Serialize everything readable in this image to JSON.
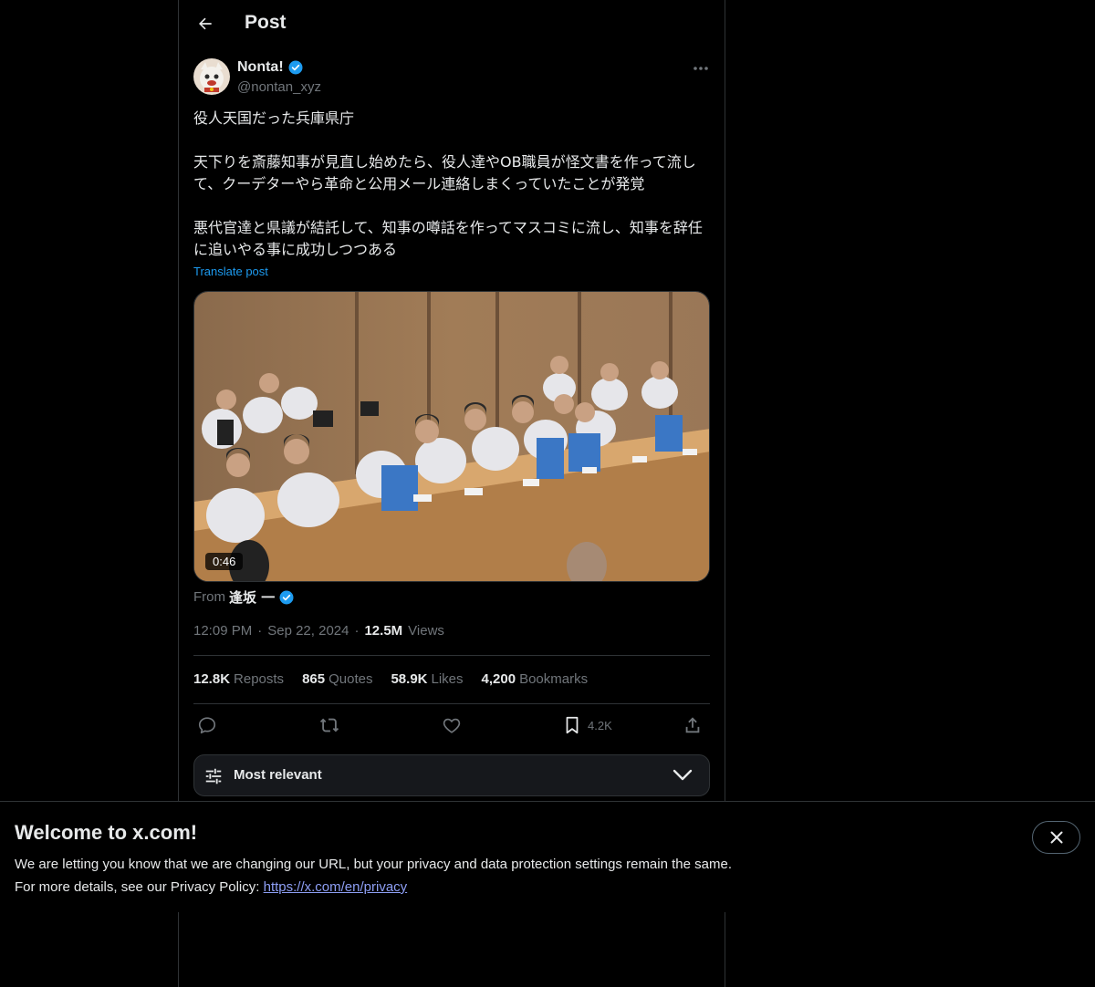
{
  "header": {
    "title": "Post"
  },
  "post": {
    "author_name": "Nonta!",
    "author_handle": "@nontan_xyz",
    "text": "役人天国だった兵庫県庁\n\n天下りを斎藤知事が見直し始めたら、役人達やOB職員が怪文書を作って流して、クーデターやら革命と公用メール連絡しまくっていたことが発覚\n\n悪代官達と県議が結託して、知事の噂話を作ってマスコミに流し、知事を辞任に追いやる事に成功しつつある",
    "translate_label": "Translate post",
    "video_duration": "0:46",
    "from_prefix": "From",
    "from_name": "逢坂 一",
    "time": "12:09 PM",
    "date": "Sep 22, 2024",
    "separator": "·",
    "views_count": "12.5M",
    "views_label": "Views"
  },
  "stats": [
    {
      "num": "12.8K",
      "label": "Reposts"
    },
    {
      "num": "865",
      "label": "Quotes"
    },
    {
      "num": "58.9K",
      "label": "Likes"
    },
    {
      "num": "4,200",
      "label": "Bookmarks"
    }
  ],
  "actions": {
    "bookmark_count": "4.2K"
  },
  "sort": {
    "label": "Most relevant"
  },
  "banner": {
    "title": "Welcome to x.com!",
    "line1": "We are letting you know that we are changing our URL, but your privacy and data protection settings remain the same.",
    "line2_prefix": "For more details, see our Privacy Policy:",
    "link": "https://x.com/en/privacy"
  },
  "colors": {
    "background": "#000000",
    "accent": "#1d9bf0",
    "text": "#e7e9ea",
    "muted": "#71767b",
    "border": "#2f3336"
  },
  "icons": [
    "back-arrow-icon",
    "verified-badge-icon",
    "more-icon",
    "reply-icon",
    "repost-icon",
    "like-icon",
    "bookmark-icon",
    "share-icon",
    "sort-filter-icon",
    "chevron-down-icon",
    "close-icon"
  ]
}
